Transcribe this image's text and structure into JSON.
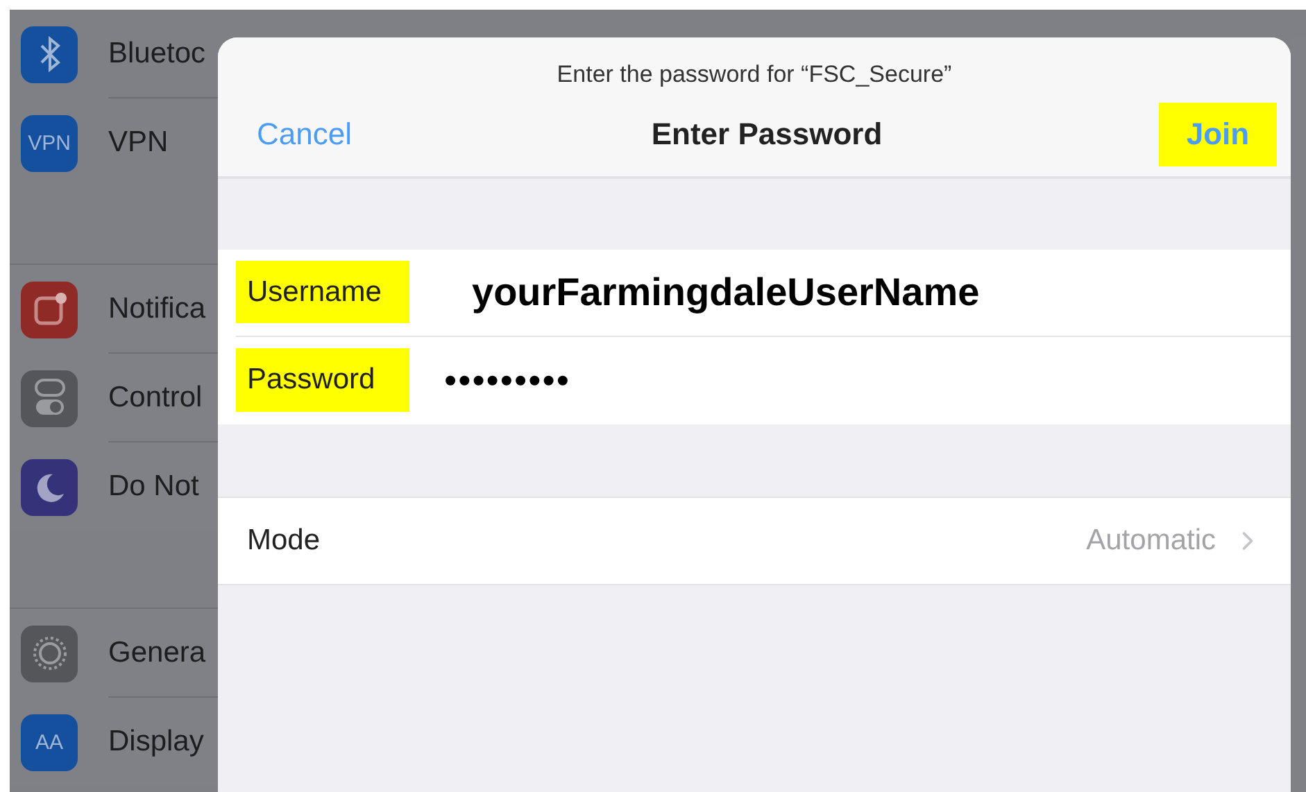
{
  "sidebar": {
    "sections": [
      {
        "items": [
          {
            "kind": "bluetooth",
            "label": "Bluetoc"
          },
          {
            "kind": "vpn",
            "icon_text": "VPN",
            "label": "VPN"
          }
        ]
      },
      {
        "items": [
          {
            "kind": "notifications",
            "label": "Notifica"
          },
          {
            "kind": "control",
            "label": "Control"
          },
          {
            "kind": "moon",
            "label": "Do Not"
          }
        ]
      },
      {
        "items": [
          {
            "kind": "general",
            "label": "Genera"
          },
          {
            "kind": "display",
            "icon_text": "AA",
            "label": "Display"
          }
        ]
      }
    ]
  },
  "dialog": {
    "prompt": "Enter the password for “FSC_Secure”",
    "cancel": "Cancel",
    "title": "Enter Password",
    "join": {
      "label": "Join",
      "highlighted": true
    },
    "fields": [
      {
        "kind": "text",
        "label": "Username",
        "highlighted": true,
        "value": "yourFarmingdaleUserName"
      },
      {
        "kind": "password",
        "label": "Password",
        "highlighted": true,
        "value": "•••••••••"
      }
    ],
    "mode": {
      "label": "Mode",
      "value": "Automatic"
    }
  }
}
